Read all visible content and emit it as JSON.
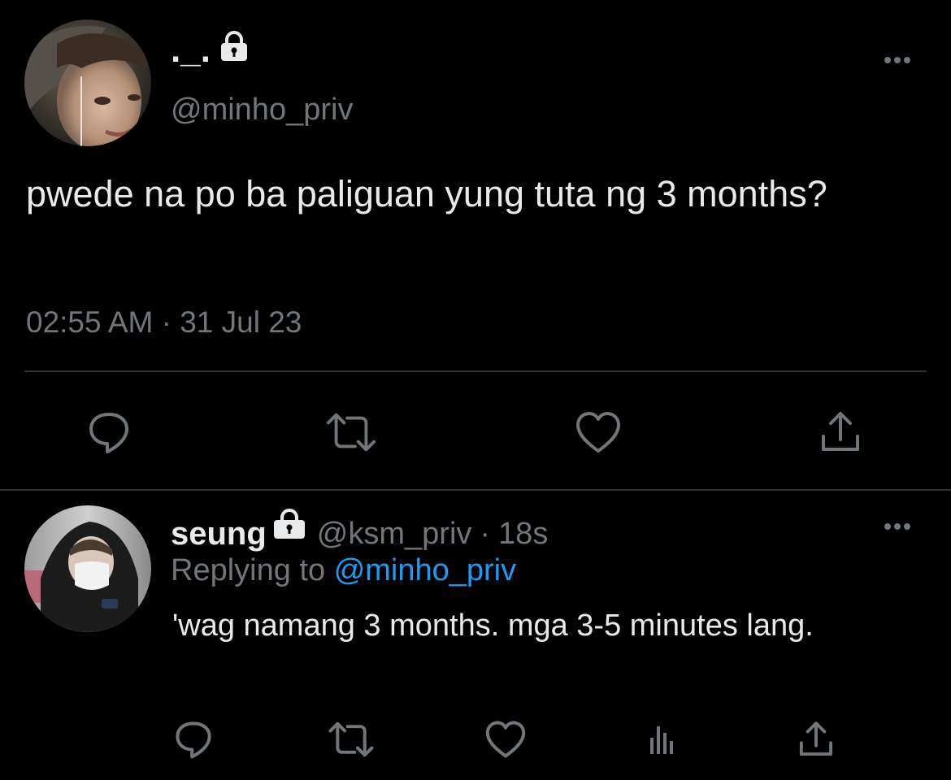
{
  "main_tweet": {
    "display_name": "._.",
    "handle": "@minho_priv",
    "text": "pwede na po ba paliguan yung tuta ng 3 months?",
    "timestamp": "02:55 AM · 31 Jul 23",
    "actions": [
      "reply-icon",
      "retweet-icon",
      "like-icon",
      "share-icon"
    ],
    "more_icon": "more-icon",
    "protected_icon": "lock-icon"
  },
  "reply": {
    "display_name": "seung",
    "handle": "@ksm_priv",
    "separator": "·",
    "time": "18s",
    "replying_prefix": "Replying to",
    "replying_mention": "@minho_priv",
    "text": "'wag namang 3 months. mga 3-5 minutes lang.",
    "actions": [
      "reply-icon",
      "retweet-icon",
      "like-icon",
      "views-icon",
      "share-icon"
    ],
    "more_icon": "more-icon",
    "protected_icon": "lock-icon"
  },
  "colors": {
    "background": "#000000",
    "text_primary": "#e7e9ea",
    "text_secondary": "#71767b",
    "accent": "#1d9bf0",
    "divider": "#2f3336"
  }
}
